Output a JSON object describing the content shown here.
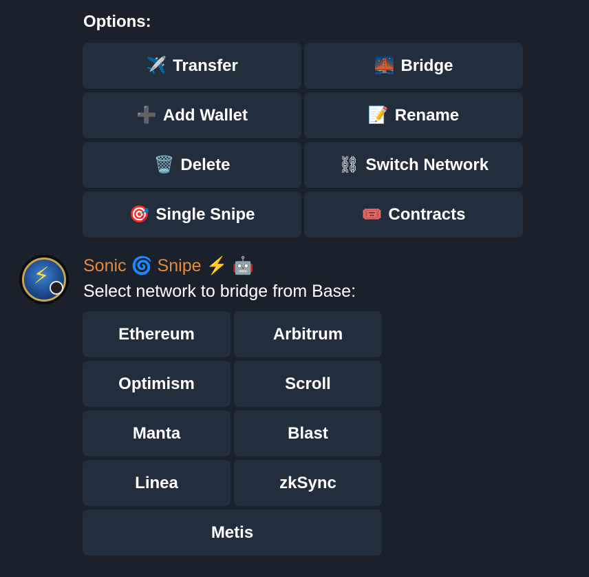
{
  "options": {
    "label": "Options:",
    "buttons": [
      {
        "emoji": "✈️",
        "label": "Transfer",
        "icon": "airplane-icon"
      },
      {
        "emoji": "🌉",
        "label": "Bridge",
        "icon": "bridge-icon"
      },
      {
        "emoji": "➕",
        "label": "Add Wallet",
        "icon": "plus-icon"
      },
      {
        "emoji": "📝",
        "label": "Rename",
        "icon": "memo-icon"
      },
      {
        "emoji": "🗑️",
        "label": "Delete",
        "icon": "trash-icon"
      },
      {
        "emoji": "⛓",
        "label": "Switch Network",
        "icon": "chain-icon"
      },
      {
        "emoji": "🎯",
        "label": "Single Snipe",
        "icon": "target-icon"
      },
      {
        "emoji": "🎟️",
        "label": "Contracts",
        "icon": "ticket-icon"
      }
    ]
  },
  "message": {
    "sender": "Sonic 🌀 Snipe ⚡️ 🤖",
    "text": "Select network to bridge from Base:",
    "avatar_icon": "lightning-bot-avatar-icon"
  },
  "networks": {
    "buttons": [
      {
        "label": "Ethereum"
      },
      {
        "label": "Arbitrum"
      },
      {
        "label": "Optimism"
      },
      {
        "label": "Scroll"
      },
      {
        "label": "Manta"
      },
      {
        "label": "Blast"
      },
      {
        "label": "Linea"
      },
      {
        "label": "zkSync"
      },
      {
        "label": "Metis"
      }
    ]
  },
  "colors": {
    "background": "#1b212b",
    "button": "#232e3d",
    "sender_name": "#e48a3a",
    "text": "#ffffff"
  }
}
